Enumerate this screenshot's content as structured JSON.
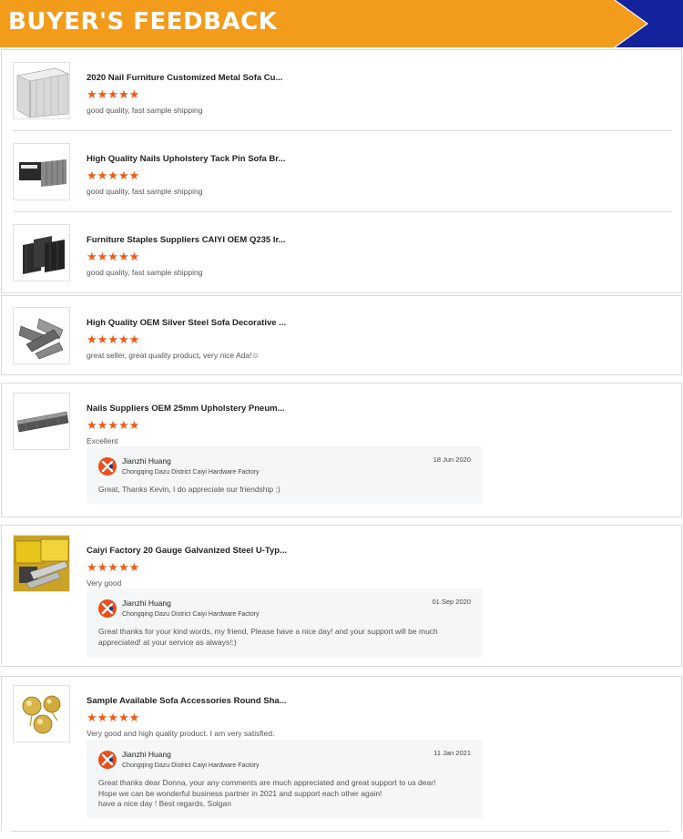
{
  "header": {
    "title": "BUYER'S FEEDBACK",
    "bg_color": "#f39b1a",
    "accent_color": "#14239b"
  },
  "star_color": "#ef5a17",
  "reviews": [
    {
      "product": "2020 Nail Furniture Customized Metal Sofa Cu...",
      "rating": 5,
      "stars": "★★★★★",
      "comment": "good quality, fast sample shipping",
      "image": "nail-strip-image"
    },
    {
      "product": "High Quality Nails Upholstery Tack Pin Sofa Br...",
      "rating": 5,
      "stars": "★★★★★",
      "comment": "good quality, fast sample shipping",
      "image": "staple-box-image"
    },
    {
      "product": "Furniture Staples Suppliers CAIYI OEM Q235 Ir...",
      "rating": 5,
      "stars": "★★★★★",
      "comment": "good quality, fast sample shipping",
      "image": "black-staples-image"
    },
    {
      "product": "High Quality OEM Silver Steel Sofa Decorative ...",
      "rating": 5,
      "stars": "★★★★★",
      "comment": "great seller, great quality product, very nice Ada!☺",
      "image": "silver-staples-image"
    },
    {
      "product": "Nails Suppliers OEM 25mm Upholstery Pneum...",
      "rating": 5,
      "stars": "★★★★★",
      "comment": "Excellent",
      "image": "brad-nail-strip-image",
      "reply": {
        "name": "Jianzhi Huang",
        "company": "Chongqing Dazu District Caiyi Hardware Factory",
        "date": "18 Jun 2020",
        "lines": [
          "Great, Thanks Kevin, I do appreciate our friendship :)"
        ]
      }
    },
    {
      "product": "Caiyi Factory 20 Gauge Galvanized Steel U-Typ...",
      "rating": 5,
      "stars": "★★★★★",
      "comment": "Very good",
      "image": "yellow-box-staples-image",
      "reply": {
        "name": "Jianzhi Huang",
        "company": "Chongqing Dazu District Caiyi Hardware Factory",
        "date": "01 Sep 2020",
        "lines": [
          "Great thanks for your kind words, my friend, Please have a nice day! and your support will be much",
          "appreciated! at your service as always!:)"
        ]
      }
    },
    {
      "product": "Sample Available Sofa Accessories Round Sha...",
      "rating": 5,
      "stars": "★★★★★",
      "comment": "Very good and high quality product. I am very satisfied.",
      "image": "gold-tacks-image",
      "reply": {
        "name": "Jianzhi Huang",
        "company": "Chongqing Dazu District Caiyi Hardware Factory",
        "date": "11 Jan 2021",
        "lines": [
          "Great thanks dear Donna, your any comments are much appreciated and great support to us dear!",
          "Hope we can be wonderful business partner in 2021 and support each other again!",
          "have a nice day ! Best regards, Solgan"
        ]
      }
    }
  ]
}
